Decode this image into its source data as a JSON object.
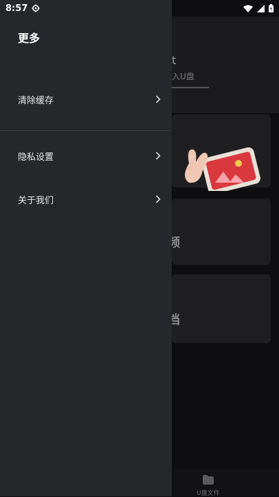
{
  "status_bar": {
    "time": "8:57",
    "icons": [
      "settings-gear-icon",
      "wifi-icon",
      "cell-signal-icon",
      "battery-icon"
    ]
  },
  "drawer": {
    "title": "更多",
    "items": [
      {
        "label": "清除缓存",
        "icon": "chevron-right-icon"
      },
      {
        "label": "隐私设置",
        "icon": "chevron-right-icon"
      },
      {
        "label": "关于我们",
        "icon": "chevron-right-icon"
      }
    ]
  },
  "background": {
    "header_text_partial": "t",
    "header_sub_partial": "入U盘",
    "card2_text_partial": "频",
    "card3_text_partial": "档",
    "bottom_nav_label": "U盘文件"
  },
  "colors": {
    "drawer_bg": "#26272b",
    "app_bg": "#0e0e10",
    "illustration_red": "#d9383f"
  }
}
